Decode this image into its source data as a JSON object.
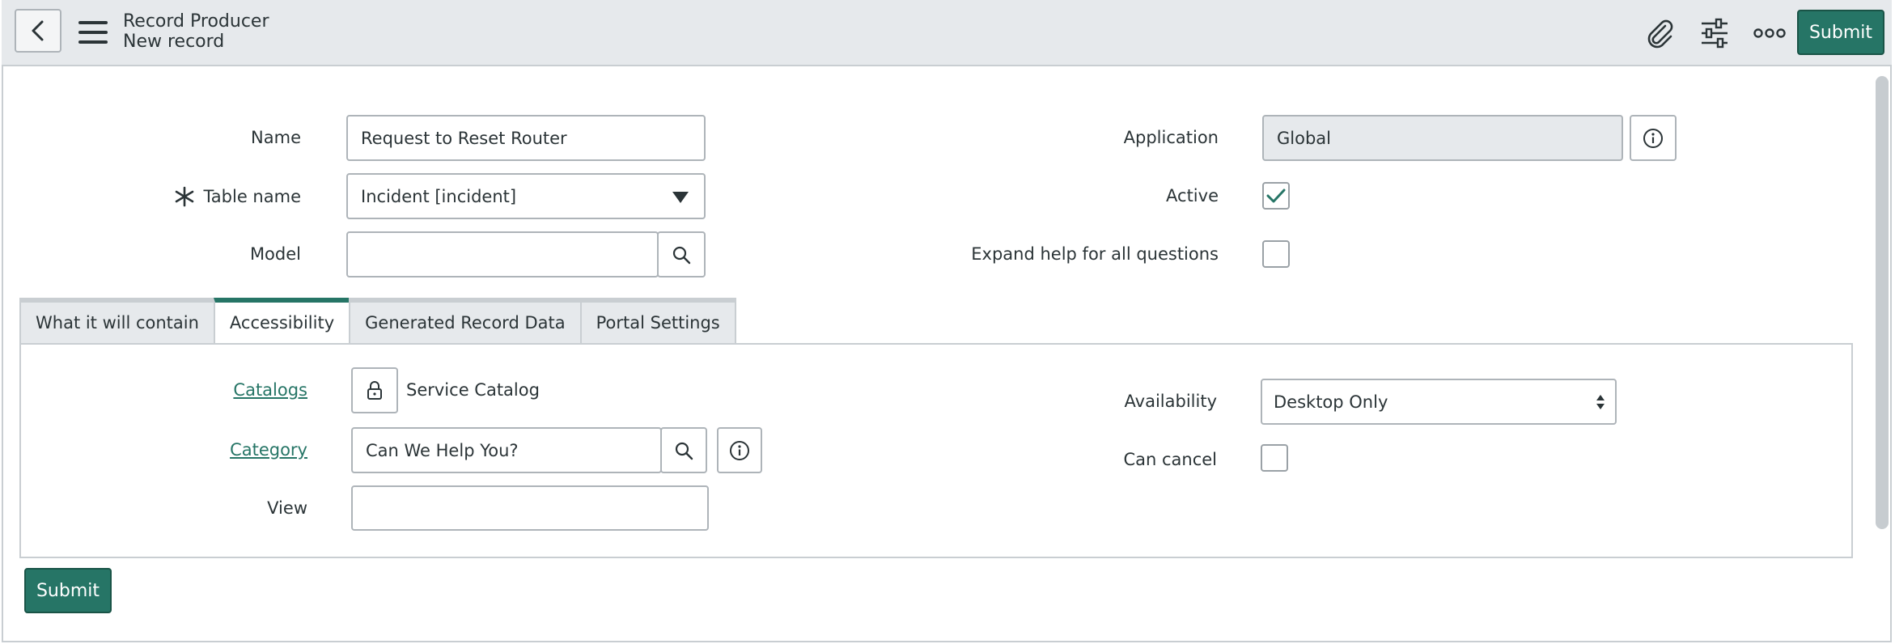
{
  "header": {
    "title": "Record Producer",
    "subtitle": "New record",
    "submit_label": "Submit",
    "icons": [
      "back-icon",
      "hamburger-menu-icon",
      "paperclip-icon",
      "sliders-icon",
      "more-icon"
    ]
  },
  "form": {
    "name": {
      "label": "Name",
      "value": "Request to Reset Router"
    },
    "table_name": {
      "label": "Table name",
      "value": "Incident [incident]",
      "required": true
    },
    "model": {
      "label": "Model",
      "value": ""
    },
    "application": {
      "label": "Application",
      "value": "Global"
    },
    "active": {
      "label": "Active",
      "checked": true
    },
    "expand_help": {
      "label": "Expand help for all questions",
      "checked": false
    }
  },
  "tabs": [
    {
      "label": "What it will contain",
      "active": false
    },
    {
      "label": "Accessibility",
      "active": true
    },
    {
      "label": "Generated Record Data",
      "active": false
    },
    {
      "label": "Portal Settings",
      "active": false
    }
  ],
  "accessibility": {
    "catalogs": {
      "label": "Catalogs",
      "value": "Service Catalog"
    },
    "category": {
      "label": "Category",
      "value": "Can We Help You?"
    },
    "view": {
      "label": "View",
      "value": ""
    },
    "availability": {
      "label": "Availability",
      "value": "Desktop Only"
    },
    "can_cancel": {
      "label": "Can cancel",
      "checked": false
    }
  },
  "footer": {
    "submit_label": "Submit"
  },
  "colors": {
    "accent": "#267566",
    "header_bg": "#e6e9ec",
    "border": "#aeb4b9"
  }
}
